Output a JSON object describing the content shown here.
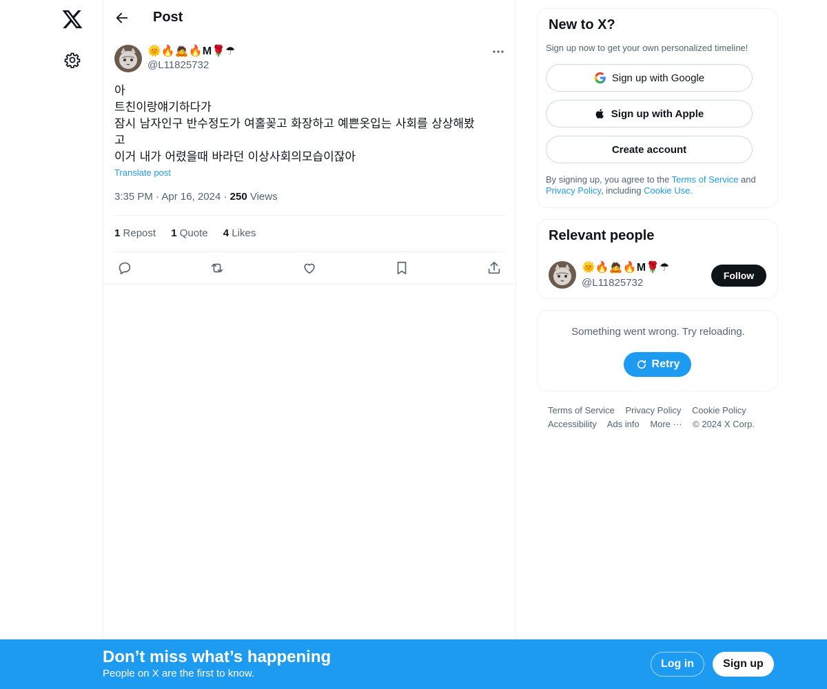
{
  "nav": {
    "logo_icon": "x-logo-icon",
    "settings_icon": "gear-icon"
  },
  "header": {
    "title": "Post",
    "back_icon": "arrow-left-icon"
  },
  "post": {
    "author_name": "🌞🔥🙇🔥M🌹☂",
    "author_handle": "@L11825732",
    "text": "아\n트친이랑얘기하다가\n잠시 남자인구 반수정도가 여홀꽂고 화장하고 예쁜옷입는 사회를 상상해봤\n고\n이거 내가 어렸을때 바라던 이상사회의모습이잖아",
    "translate_label": "Translate post",
    "time": "3:35 PM",
    "date": "Apr 16, 2024",
    "views_count": "250",
    "views_label": "Views",
    "stats": [
      {
        "count": "1",
        "label": "Repost"
      },
      {
        "count": "1",
        "label": "Quote"
      },
      {
        "count": "4",
        "label": "Likes"
      }
    ]
  },
  "signup_card": {
    "title": "New to X?",
    "subtitle": "Sign up now to get your own personalized timeline!",
    "google_label": "Sign up with Google",
    "apple_label": "Sign up with Apple",
    "create_label": "Create account",
    "legal_prefix": "By signing up, you agree to the ",
    "tos": "Terms of Service",
    "and": " and",
    "privacy": "Privacy Policy",
    "including": ", including ",
    "cookie": "Cookie Use."
  },
  "people_card": {
    "title": "Relevant people",
    "name": "🌞🔥🙇🔥M🌹☂",
    "handle": "@L11825732",
    "follow_label": "Follow"
  },
  "error_card": {
    "message": "Something went wrong. Try reloading.",
    "retry_label": "Retry"
  },
  "footer": {
    "links": [
      "Terms of Service",
      "Privacy Policy",
      "Cookie Policy",
      "Accessibility",
      "Ads info",
      "More ···",
      "© 2024 X Corp."
    ]
  },
  "bottom_bar": {
    "title": "Don’t miss what’s happening",
    "subtitle": "People on X are the first to know.",
    "login_label": "Log in",
    "signup_label": "Sign up"
  },
  "colors": {
    "accent": "#1d9bf0",
    "text": "#0f1419",
    "muted": "#536471",
    "border": "#eff3f4"
  }
}
